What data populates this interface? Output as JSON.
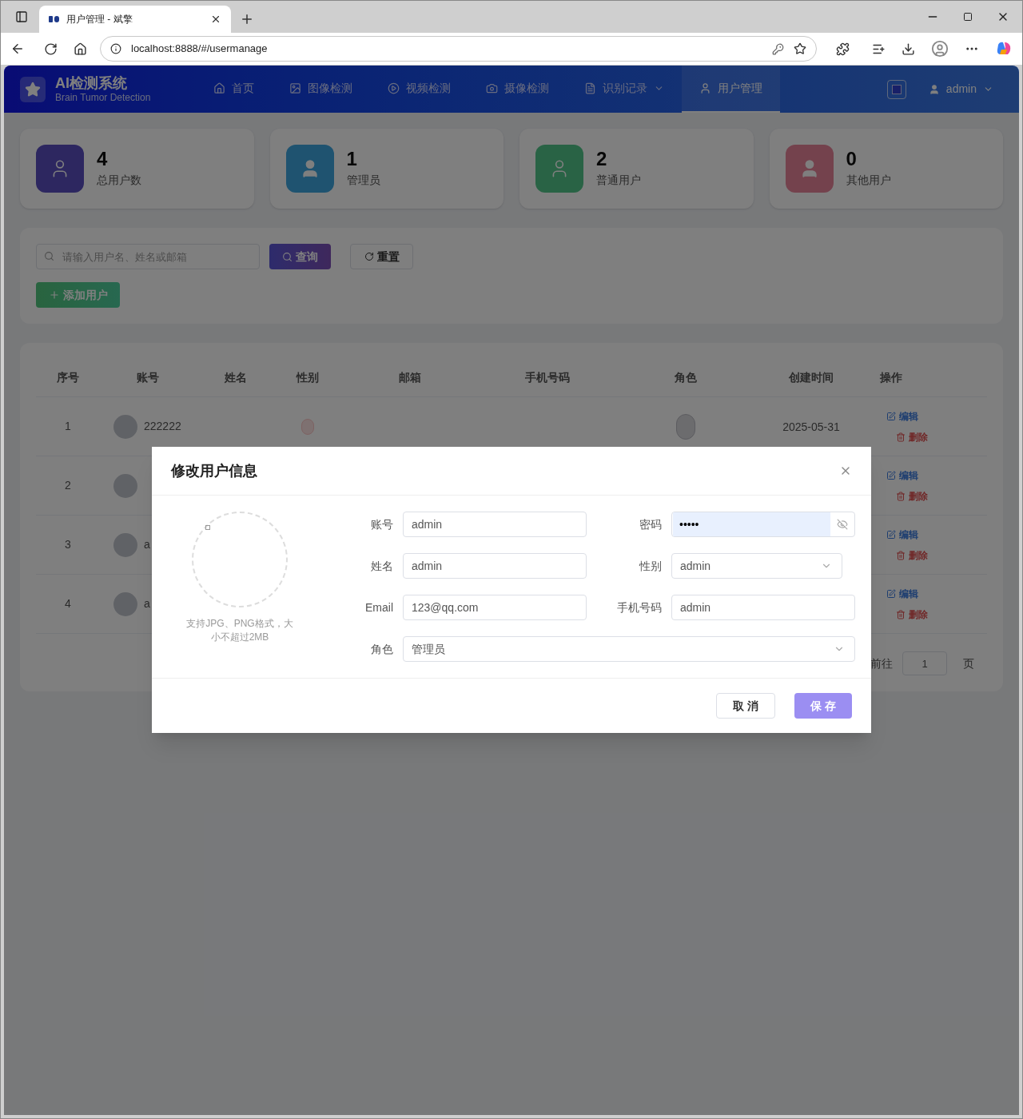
{
  "browser": {
    "tab_title": "用户管理 - 斌擎",
    "url": "localhost:8888/#/usermanage"
  },
  "header": {
    "title": "AI检测系统",
    "subtitle": "Brain Tumor Detection",
    "user": "admin",
    "nav": [
      {
        "label": "首页",
        "selected": false,
        "dropdown": false
      },
      {
        "label": "图像检测",
        "selected": false,
        "dropdown": false
      },
      {
        "label": "视频检测",
        "selected": false,
        "dropdown": false
      },
      {
        "label": "摄像检测",
        "selected": false,
        "dropdown": false
      },
      {
        "label": "识别记录",
        "selected": false,
        "dropdown": true
      },
      {
        "label": "用户管理",
        "selected": true,
        "dropdown": false
      }
    ]
  },
  "stats": [
    {
      "value": "4",
      "label": "总用户数",
      "kind": "outline"
    },
    {
      "value": "1",
      "label": "管理员",
      "kind": "filled"
    },
    {
      "value": "2",
      "label": "普通用户",
      "kind": "outline"
    },
    {
      "value": "0",
      "label": "其他用户",
      "kind": "filled"
    }
  ],
  "search": {
    "placeholder": "请输入用户名、姓名或邮箱",
    "query_button": "查询",
    "reset_button": "重置",
    "add_button": "添加用户"
  },
  "table": {
    "columns": [
      "序号",
      "账号",
      "姓名",
      "性别",
      "邮箱",
      "手机号码",
      "角色",
      "创建时间",
      "操作"
    ],
    "rows": [
      {
        "index": "1",
        "account": "222222",
        "tags_shown": true,
        "created": "2025-05-31",
        "actions": [
          "编辑",
          "删除"
        ]
      },
      {
        "index": "2",
        "actions": [
          "编辑",
          "删除"
        ]
      },
      {
        "index": "3",
        "account": "a",
        "actions": [
          "编辑",
          "删除"
        ]
      },
      {
        "index": "4",
        "account": "a",
        "actions": [
          "编辑",
          "删除"
        ]
      }
    ],
    "pagination": {
      "goto_label": "前往",
      "page": "1",
      "page_suffix": "页"
    }
  },
  "dialog": {
    "title": "修改用户信息",
    "avatar_hint": "支持JPG、PNG格式，大小不超过2MB",
    "rows": [
      [
        {
          "label": "账号",
          "value": "admin",
          "kind": "text",
          "autofilled": false
        },
        {
          "label": "密码",
          "value": "•••••",
          "kind": "password",
          "autofilled": true
        }
      ],
      [
        {
          "label": "姓名",
          "value": "admin",
          "kind": "text",
          "autofilled": false
        },
        {
          "label": "性别",
          "value": "admin",
          "kind": "select",
          "autofilled": false
        }
      ],
      [
        {
          "label": "Email",
          "value": "123@qq.com",
          "kind": "text",
          "autofilled": false
        },
        {
          "label": "手机号码",
          "value": "admin",
          "kind": "text",
          "autofilled": false
        }
      ],
      [
        {
          "label": "角色",
          "value": "管理员",
          "kind": "select",
          "autofilled": false
        }
      ]
    ],
    "cancel_button": "取 消",
    "save_button": "保 存"
  }
}
